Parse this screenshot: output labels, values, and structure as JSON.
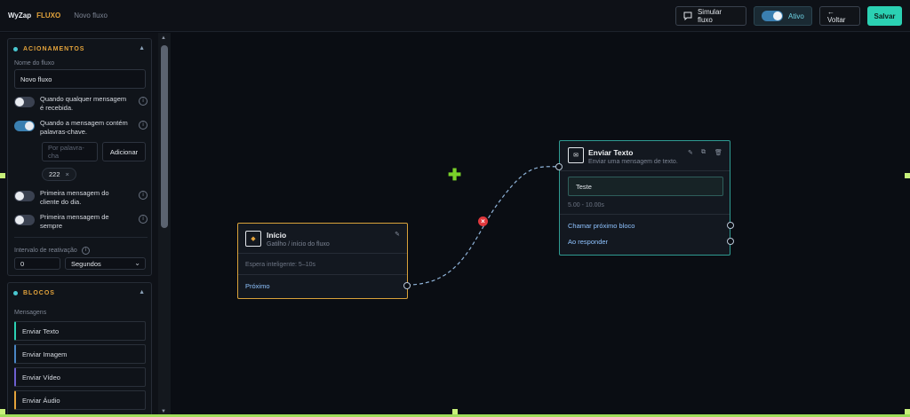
{
  "header": {
    "brand": "WyZap",
    "brand_sub": "FLUXO",
    "flow_name": "Novo fluxo",
    "simulate_label": "Simular fluxo",
    "active_label": "Ativo",
    "back_label": "← Voltar",
    "save_label": "Salvar"
  },
  "acionamentos": {
    "title": "ACIONAMENTOS",
    "name_label": "Nome do fluxo",
    "name_value": "Novo fluxo",
    "toggles": [
      {
        "text": "Quando qualquer mensagem é recebida.",
        "on": false
      },
      {
        "text": "Quando a mensagem contém palavras-chave.",
        "on": true
      },
      {
        "text": "Primeira mensagem do cliente do dia.",
        "on": false
      },
      {
        "text": "Primeira mensagem de sempre",
        "on": false
      }
    ],
    "keyword_placeholder": "Por palavra-cha",
    "add_label": "Adicionar",
    "keyword_chip": "222",
    "chip_close": "×",
    "interval_label": "Intervalo de reativação",
    "interval_value": "0",
    "interval_unit": "Segundos"
  },
  "blocos": {
    "title": "BLOCOS",
    "section_label": "Mensagens",
    "items": [
      "Enviar Texto",
      "Enviar Imagem",
      "Enviar Vídeo",
      "Enviar Áudio"
    ]
  },
  "node_inicio": {
    "title": "Início",
    "subtitle": "Gatilho / início do fluxo",
    "wait_text": "Espera inteligente: 5–10s",
    "next_label": "Próximo"
  },
  "node_enviar": {
    "title": "Enviar Texto",
    "subtitle": "Enviar uma mensagem de texto.",
    "message": "Teste",
    "timing": "5.00 - 10.00s",
    "call_next": "Chamar próximo bloco",
    "on_reply": "Ao responder"
  },
  "colors": {
    "accent_teal": "#2bd1b3",
    "accent_orange": "#e3a33b",
    "connector": "#8fb3d9",
    "delete_red": "#e0383d"
  }
}
